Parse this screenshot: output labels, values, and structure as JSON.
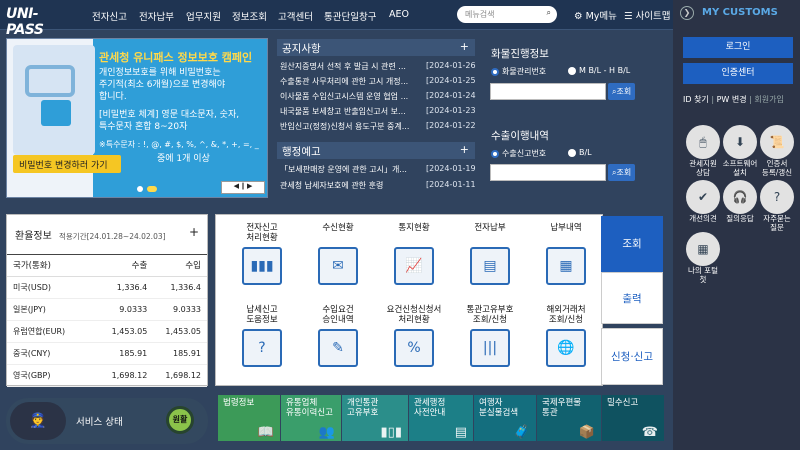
{
  "header": {
    "logo": "UNI-PASS",
    "nav": [
      "전자신고",
      "전자납부",
      "업무지원",
      "정보조회",
      "고객센터",
      "통관단일창구",
      "AEO"
    ],
    "search_placeholder": "메뉴검색",
    "my_menu": "My메뉴",
    "sitemap": "사이트맵"
  },
  "banner": {
    "title": "관세청 유니패스 정보보호 캠페인",
    "line1": "개인정보보호를 위해 비밀번호는",
    "line2": "주기적(최소 6개월)으로 변경해야",
    "line3": "합니다.",
    "line4": "[비밀번호 체계] 영문 대소문자, 숫자,",
    "line5": "특수문자 혼합 8~20자",
    "line6": "※특수문자 : !, @, #, $, %, ^, &, *, +, =, _",
    "line7": "중에 1개 이상",
    "badge": "비밀번호 변경하러 가기",
    "ctrl": "◀ ∥ ▶"
  },
  "notice": {
    "title": "공지사항",
    "plus": "+",
    "items": [
      {
        "text": "원산지증명서 선적 후 발급 시 관련 ...",
        "date": "[2024-01-26]"
      },
      {
        "text": "수출통관 사무처리에 관한 고시 개정...",
        "date": "[2024-01-25]"
      },
      {
        "text": "이사물품 수입신고시스템 운영 협업 ...",
        "date": "[2024-01-24]"
      },
      {
        "text": "내국물품 보세창고 반출입신고서 보...",
        "date": "[2024-01-23]"
      },
      {
        "text": "반입신고(정정)신청서 용도구분 중계...",
        "date": "[2024-01-22]"
      }
    ]
  },
  "press": {
    "title": "행정예고",
    "plus": "+",
    "items": [
      {
        "text": "「보세판매장 운영에 관한 고시」개...",
        "date": "[2024-01-19]"
      },
      {
        "text": "관세청 납세자보호에 관한 훈령",
        "date": "[2024-01-11]"
      }
    ]
  },
  "cargo": {
    "title": "화물진행정보",
    "opt1": "화물관리번호",
    "opt2": "M B/L - H B/L",
    "btn": "조회"
  },
  "export": {
    "title": "수출이행내역",
    "opt1": "수출신고번호",
    "opt2": "B/L",
    "btn": "조회"
  },
  "fx": {
    "title": "환율정보",
    "period": "적용기간[24.01.28~24.02.03]",
    "plus": "+",
    "head": [
      "국가(통화)",
      "수출",
      "수입"
    ],
    "rows": [
      [
        "미국(USD)",
        "1,336.4",
        "1,336.4"
      ],
      [
        "일본(JPY)",
        "9.0333",
        "9.0333"
      ],
      [
        "유럽연합(EUR)",
        "1,453.05",
        "1,453.05"
      ],
      [
        "중국(CNY)",
        "185.91",
        "185.91"
      ],
      [
        "영국(GBP)",
        "1,698.12",
        "1,698.12"
      ]
    ]
  },
  "services": [
    {
      "l1": "전자신고",
      "l2": "처리현황"
    },
    {
      "l1": "수신현황",
      "l2": ""
    },
    {
      "l1": "통지현황",
      "l2": ""
    },
    {
      "l1": "전자납부",
      "l2": ""
    },
    {
      "l1": "납부내역",
      "l2": ""
    },
    {
      "l1": "납세신고",
      "l2": "도움정보"
    },
    {
      "l1": "수입요건",
      "l2": "승인내역"
    },
    {
      "l1": "요건신청신청서",
      "l2": "처리현황"
    },
    {
      "l1": "통관고유부호",
      "l2": "조회/신청"
    },
    {
      "l1": "해외거래처",
      "l2": "조회/신청"
    }
  ],
  "tabs": [
    "조회",
    "출력",
    "신청·신고"
  ],
  "status": {
    "label": "서비스 상태",
    "state": "원활"
  },
  "tiles": [
    {
      "l1": "법령정보",
      "l2": "",
      "color": "#3c9a58"
    },
    {
      "l1": "유통업체",
      "l2": "유통이력신고",
      "color": "#3a9e6b"
    },
    {
      "l1": "개인통관",
      "l2": "고유부호",
      "color": "#2b8e8a"
    },
    {
      "l1": "관세행정",
      "l2": "사전안내",
      "color": "#1c7f87"
    },
    {
      "l1": "여행자",
      "l2": "분실물검색",
      "color": "#146e7e"
    },
    {
      "l1": "국제우편물",
      "l2": "통관",
      "color": "#11616f"
    },
    {
      "l1": "밀수신고",
      "l2": "",
      "color": "#0f5260"
    }
  ],
  "sidebar": {
    "title": "MY CUSTOMS",
    "login": "로그인",
    "cert": "인증센터",
    "links": [
      "ID 찾기",
      "PW 변경",
      "회원가입"
    ],
    "icons": [
      {
        "l1": "관세지원",
        "l2": "상담"
      },
      {
        "l1": "소프트웨어",
        "l2": "설치"
      },
      {
        "l1": "인증서",
        "l2": "등록/갱신"
      },
      {
        "l1": "개선의견",
        "l2": ""
      },
      {
        "l1": "질의응답",
        "l2": ""
      },
      {
        "l1": "자주묻는",
        "l2": "질문"
      },
      {
        "l1": "나의 포털",
        "l2": "첫"
      }
    ]
  }
}
